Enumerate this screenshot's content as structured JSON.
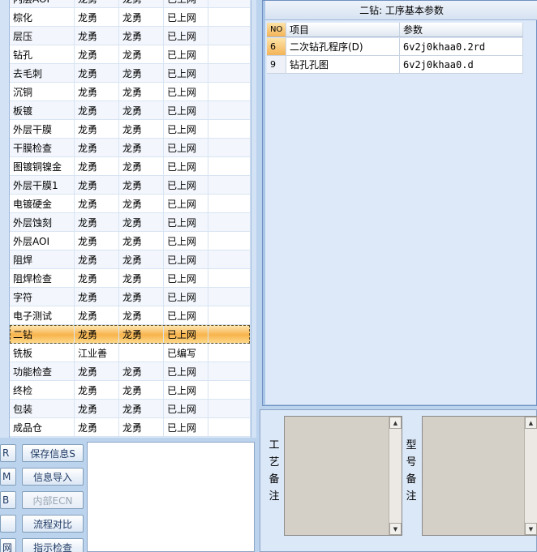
{
  "process_table": {
    "partial_top_row": [
      "内层AOI",
      "龙勇",
      "龙勇",
      "已上网"
    ],
    "rows": [
      {
        "name": "棕化",
        "op1": "龙勇",
        "op2": "龙勇",
        "status": "已上网"
      },
      {
        "name": "层压",
        "op1": "龙勇",
        "op2": "龙勇",
        "status": "已上网"
      },
      {
        "name": "钻孔",
        "op1": "龙勇",
        "op2": "龙勇",
        "status": "已上网"
      },
      {
        "name": "去毛刺",
        "op1": "龙勇",
        "op2": "龙勇",
        "status": "已上网"
      },
      {
        "name": "沉铜",
        "op1": "龙勇",
        "op2": "龙勇",
        "status": "已上网"
      },
      {
        "name": "板镀",
        "op1": "龙勇",
        "op2": "龙勇",
        "status": "已上网"
      },
      {
        "name": "外层干膜",
        "op1": "龙勇",
        "op2": "龙勇",
        "status": "已上网"
      },
      {
        "name": "干膜检查",
        "op1": "龙勇",
        "op2": "龙勇",
        "status": "已上网"
      },
      {
        "name": "图镀铜镍金",
        "op1": "龙勇",
        "op2": "龙勇",
        "status": "已上网"
      },
      {
        "name": "外层干膜1",
        "op1": "龙勇",
        "op2": "龙勇",
        "status": "已上网"
      },
      {
        "name": "电镀硬金",
        "op1": "龙勇",
        "op2": "龙勇",
        "status": "已上网"
      },
      {
        "name": "外层蚀刻",
        "op1": "龙勇",
        "op2": "龙勇",
        "status": "已上网"
      },
      {
        "name": "外层AOI",
        "op1": "龙勇",
        "op2": "龙勇",
        "status": "已上网"
      },
      {
        "name": "阻焊",
        "op1": "龙勇",
        "op2": "龙勇",
        "status": "已上网"
      },
      {
        "name": "阻焊检查",
        "op1": "龙勇",
        "op2": "龙勇",
        "status": "已上网"
      },
      {
        "name": "字符",
        "op1": "龙勇",
        "op2": "龙勇",
        "status": "已上网"
      },
      {
        "name": "电子测试",
        "op1": "龙勇",
        "op2": "龙勇",
        "status": "已上网"
      },
      {
        "name": "二钻",
        "op1": "龙勇",
        "op2": "龙勇",
        "status": "已上网"
      },
      {
        "name": "铣板",
        "op1": "江业善",
        "op2": "",
        "status": "已编写"
      },
      {
        "name": "功能检查",
        "op1": "龙勇",
        "op2": "龙勇",
        "status": "已上网"
      },
      {
        "name": "终检",
        "op1": "龙勇",
        "op2": "龙勇",
        "status": "已上网"
      },
      {
        "name": "包装",
        "op1": "龙勇",
        "op2": "龙勇",
        "status": "已上网"
      },
      {
        "name": "成品仓",
        "op1": "龙勇",
        "op2": "龙勇",
        "status": "已上网"
      }
    ],
    "selected_index": 17
  },
  "buttons": {
    "stubs": [
      "R",
      "M",
      "B",
      "",
      "网"
    ],
    "save_info": "保存信息S",
    "import_info": "信息导入",
    "internal_ecn": "内部ECN",
    "flow_compare": "流程对比",
    "check_instructions": "指示检查"
  },
  "params": {
    "title": "二钻: 工序基本参数",
    "columns": {
      "no": "NO",
      "item": "项目",
      "value": "参数"
    },
    "rows": [
      {
        "no": "6",
        "item": "二次钻孔程序(D)",
        "value": "6v2j0khaa0.2rd"
      },
      {
        "no": "9",
        "item": "钻孔孔图",
        "value": "6v2j0khaa0.d"
      }
    ]
  },
  "notes": {
    "process_label": "工艺备注",
    "model_label": "型号备注"
  }
}
